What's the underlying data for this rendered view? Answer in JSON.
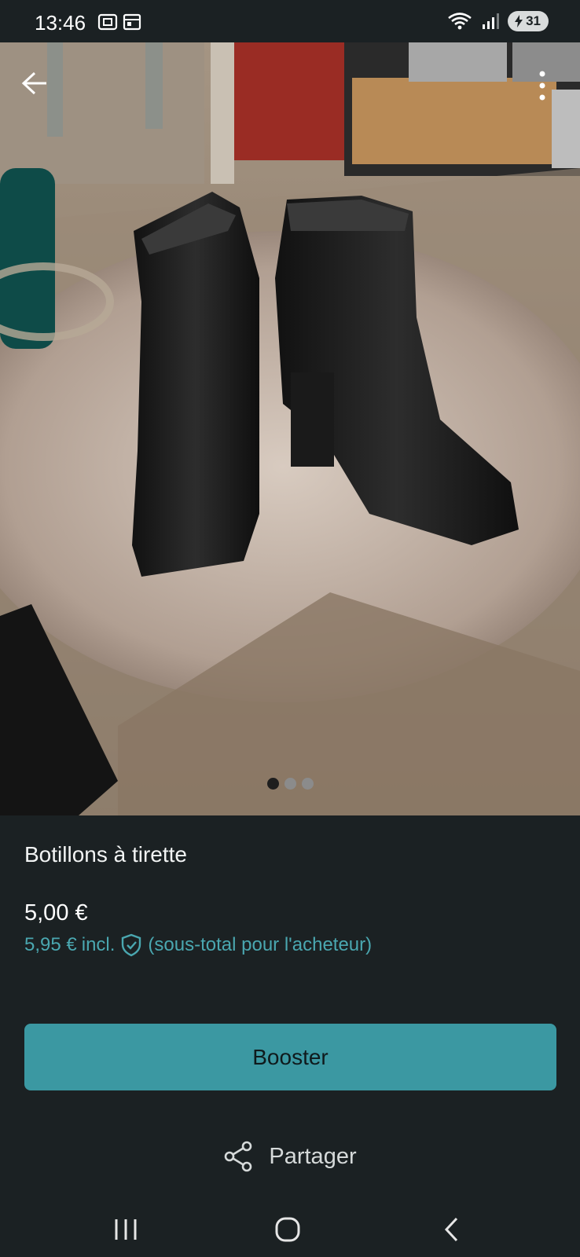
{
  "status_bar": {
    "time": "13:46",
    "battery": "31"
  },
  "item": {
    "title": "Botillons à tirette",
    "price": "5,00 €",
    "price_incl_amount": "5,95 €",
    "price_incl_label": "incl.",
    "price_incl_note": "(sous-total pour l'acheteur)"
  },
  "actions": {
    "booster_label": "Booster",
    "share_label": "Partager"
  },
  "gallery": {
    "photo_count": 3,
    "active_index": 0
  },
  "colors": {
    "background": "#1b2123",
    "accent": "#3b98a2",
    "accent_text": "#4aa7b0"
  },
  "icons": {
    "back": "arrow-left-icon",
    "more": "more-vertical-icon",
    "shield": "shield-check-icon",
    "share": "share-icon"
  }
}
